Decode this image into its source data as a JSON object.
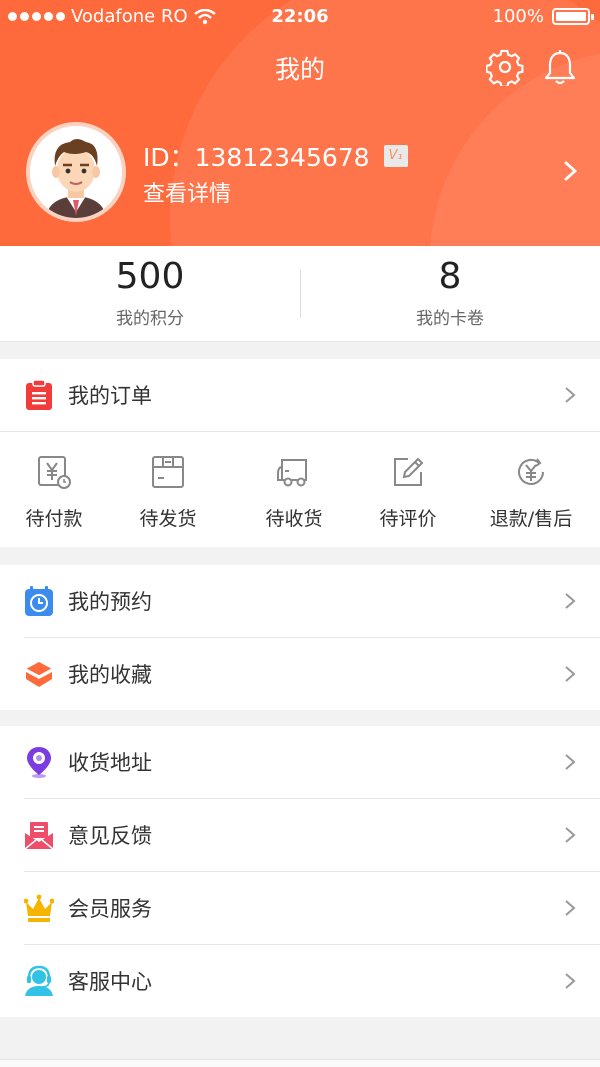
{
  "status_bar": {
    "carrier": "Vodafone RO",
    "time": "22:06",
    "battery": "100%"
  },
  "header": {
    "title": "我的",
    "id_text": "ID：13812345678",
    "vip_badge": "V₁",
    "detail": "查看详情"
  },
  "stats": [
    {
      "value": "500",
      "label": "我的积分"
    },
    {
      "value": "8",
      "label": "我的卡卷"
    }
  ],
  "orders": {
    "title": "我的订单",
    "items": [
      "待付款",
      "待发货",
      "待收货",
      "待评价",
      "退款/售后"
    ]
  },
  "group1": [
    "我的预约",
    "我的收藏"
  ],
  "group2": [
    "收货地址",
    "意见反馈",
    "会员服务",
    "客服中心"
  ],
  "colors": {
    "accent": "#ff6a3c",
    "orders_icon": "#f23c3c",
    "booking_icon": "#3c8cf0",
    "favorites_icon": "#ff6a3c",
    "address_icon": "#7b3ce0",
    "feedback_icon": "#ef4e6b",
    "member_icon": "#f5b400",
    "service_icon": "#30c3e6"
  }
}
